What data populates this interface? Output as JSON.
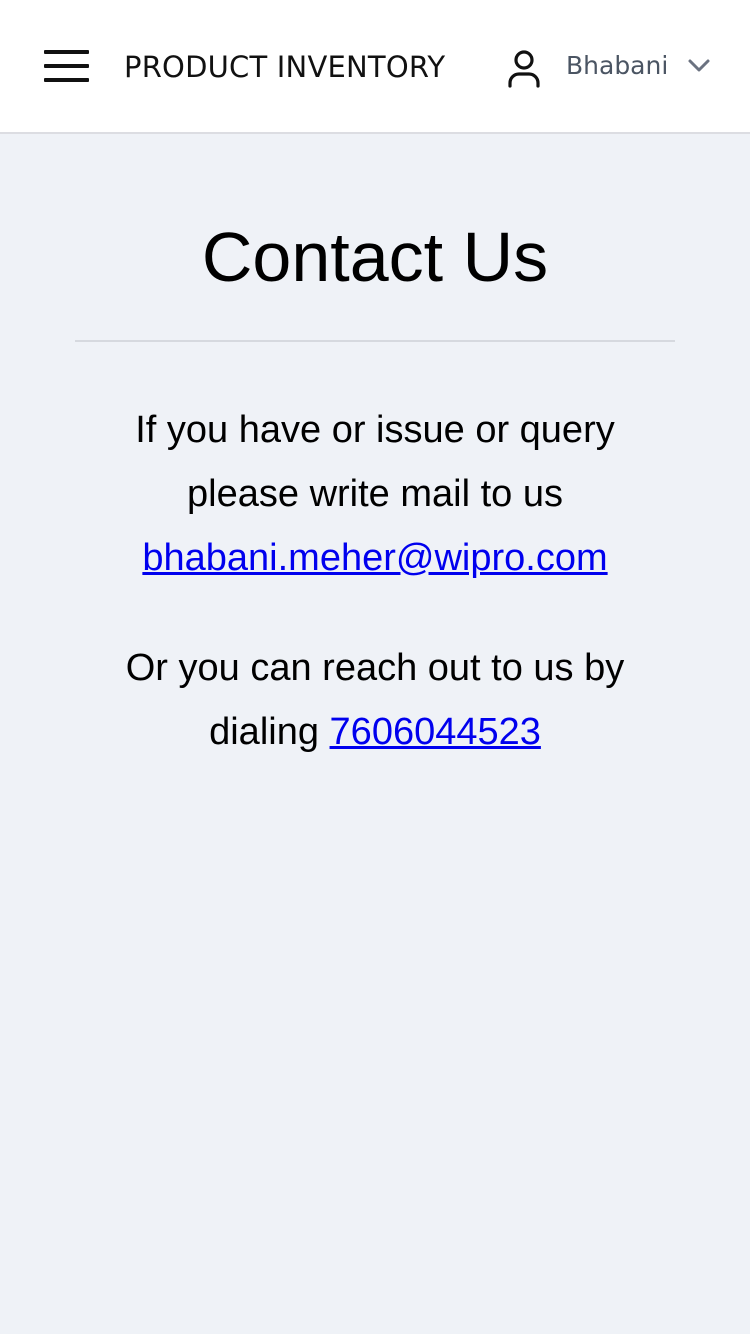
{
  "header": {
    "menu_icon": "hamburger-menu-icon",
    "brand": "PRODUCT INVENTORY",
    "user_icon": "user-icon",
    "user_name": "Bhabani",
    "dropdown_icon": "chevron-down-icon"
  },
  "main": {
    "title": "Contact Us",
    "mail_text": "If you have or issue or query please write mail to us",
    "email": "bhabani.meher@wipro.com",
    "phone_text": "Or you can reach out to us by dialing",
    "phone": "7606044523"
  },
  "colors": {
    "background": "#eff2f7",
    "header_bg": "#ffffff",
    "link": "#0000ee",
    "user_name": "#4b5563"
  }
}
